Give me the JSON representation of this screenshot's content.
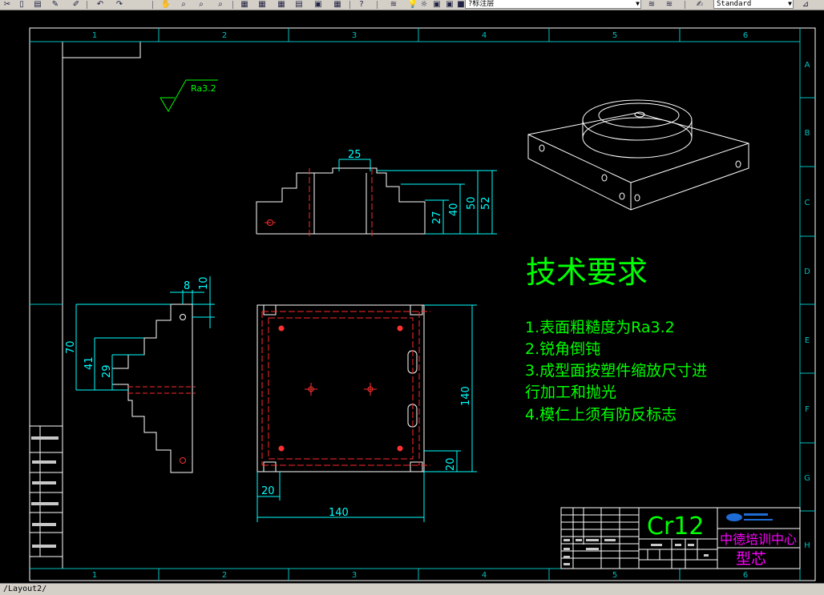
{
  "toolbar": {
    "layer_name": "?标注层",
    "style_name": "Standard"
  },
  "border": {
    "columns": [
      "1",
      "2",
      "3",
      "4",
      "5",
      "6"
    ],
    "rows": [
      "A",
      "B",
      "C",
      "D",
      "E",
      "F",
      "G",
      "H"
    ]
  },
  "roughness_symbol": "Ra3.2",
  "front_view_dims": {
    "width": "25",
    "h1": "27",
    "h2": "40",
    "h3": "50",
    "h4": "52"
  },
  "side_view_dims": {
    "w1": "8",
    "w2": "10",
    "h1": "70",
    "h2": "41",
    "h3": "29"
  },
  "top_view_dims": {
    "height": "140",
    "edge_h": "20",
    "edge_w": "20",
    "width": "140"
  },
  "requirements": {
    "title": "技术要求",
    "items": [
      "1.表面粗糙度为Ra3.2",
      "2.锐角倒钝",
      "3.成型面按塑件缩放尺寸进",
      "行加工和抛光",
      "4.模仁上须有防反标志"
    ]
  },
  "title_block": {
    "material": "Cr12",
    "company": "中德培训中心",
    "part_name": "型芯"
  },
  "status": {
    "layout_tab": "Layout2"
  }
}
